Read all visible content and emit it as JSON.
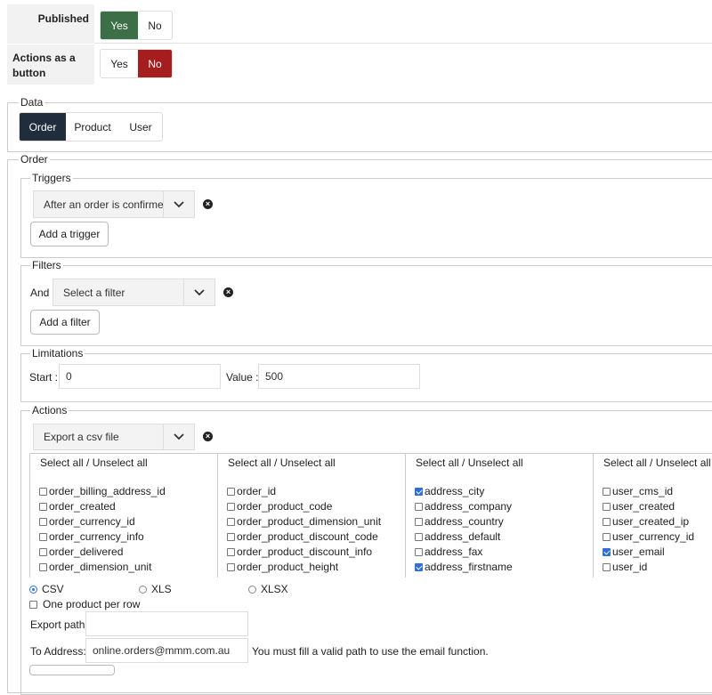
{
  "published": {
    "label": "Published",
    "yes": "Yes",
    "no": "No",
    "value": "Yes",
    "active_color": "#3c6e47"
  },
  "actions_as_button": {
    "label": "Actions as a button",
    "yes": "Yes",
    "no": "No",
    "value": "No",
    "active_color": "#a51d1f"
  },
  "data_section": {
    "legend": "Data",
    "tabs": [
      "Order",
      "Product",
      "User"
    ],
    "active_tab": "Order",
    "active_color": "#1f2d3d"
  },
  "order_section": {
    "legend": "Order",
    "triggers": {
      "legend": "Triggers",
      "selected": "After an order is confirmed",
      "add_label": "Add a trigger"
    },
    "filters": {
      "legend": "Filters",
      "and_label": "And",
      "placeholder": "Select a filter",
      "add_label": "Add a filter"
    },
    "limitations": {
      "legend": "Limitations",
      "start_label": "Start :",
      "start_value": "0",
      "value_label": "Value :",
      "value_value": "500"
    },
    "actions": {
      "legend": "Actions",
      "selected": "Export a csv file",
      "columns": [
        {
          "header": "Select all / Unselect all",
          "items": [
            {
              "label": "order_billing_address_id",
              "checked": false
            },
            {
              "label": "order_created",
              "checked": false
            },
            {
              "label": "order_currency_id",
              "checked": false
            },
            {
              "label": "order_currency_info",
              "checked": false
            },
            {
              "label": "order_delivered",
              "checked": false
            },
            {
              "label": "order_dimension_unit",
              "checked": false
            }
          ]
        },
        {
          "header": "Select all / Unselect all",
          "items": [
            {
              "label": "order_id",
              "checked": false
            },
            {
              "label": "order_product_code",
              "checked": false
            },
            {
              "label": "order_product_dimension_unit",
              "checked": false
            },
            {
              "label": "order_product_discount_code",
              "checked": false
            },
            {
              "label": "order_product_discount_info",
              "checked": false
            },
            {
              "label": "order_product_height",
              "checked": false
            }
          ]
        },
        {
          "header": "Select all / Unselect all",
          "items": [
            {
              "label": "address_city",
              "checked": true
            },
            {
              "label": "address_company",
              "checked": false
            },
            {
              "label": "address_country",
              "checked": false
            },
            {
              "label": "address_default",
              "checked": false
            },
            {
              "label": "address_fax",
              "checked": false
            },
            {
              "label": "address_firstname",
              "checked": true
            }
          ]
        },
        {
          "header": "Select all / Unselect all",
          "items": [
            {
              "label": "user_cms_id",
              "checked": false
            },
            {
              "label": "user_created",
              "checked": false
            },
            {
              "label": "user_created_ip",
              "checked": false
            },
            {
              "label": "user_currency_id",
              "checked": false
            },
            {
              "label": "user_email",
              "checked": true
            },
            {
              "label": "user_id",
              "checked": false
            }
          ]
        }
      ],
      "formats": [
        "CSV",
        "XLS",
        "XLSX"
      ],
      "selected_format": "CSV",
      "one_product_per_row": "One product per row",
      "export_path_label": "Export path:",
      "export_path_value": "",
      "to_address_label": "To Address:",
      "to_address_value": "online.orders@mmm.com.au",
      "email_hint": "You must fill a valid path to use the email function."
    }
  }
}
